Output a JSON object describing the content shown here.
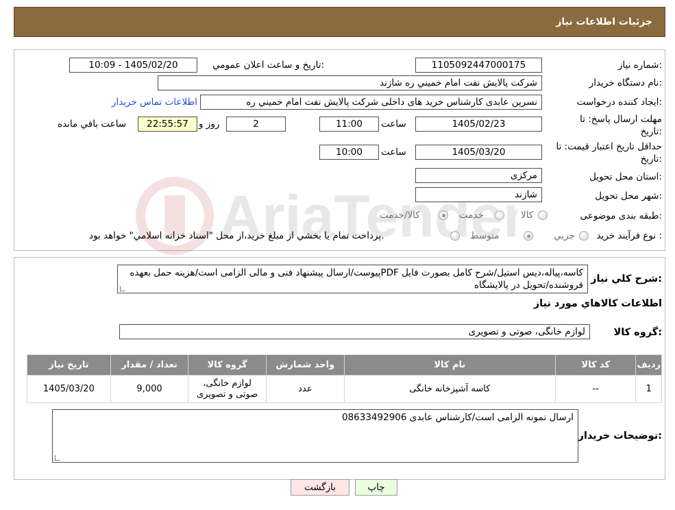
{
  "header": {
    "title": "جزئیات اطلاعات نیاز"
  },
  "form": {
    "need_number_label": "شماره نیاز:",
    "need_number": "1105092447000175",
    "announce_label": "تاریخ و ساعت اعلان عمومي:",
    "announce_value": "1405/02/20 - 10:09",
    "buyer_org_label": "نام دستگاه خريدار:",
    "buyer_org": "شرکت پالايش نفت امام خميني  ره  شازند",
    "creator_label": "ايجاد كننده درخواست:",
    "creator": "نسرين عابدی کارشناس خريد های داخلی  شرکت پالايش نفت امام خميني  ره",
    "contact_link": "اطلاعات تماس خريدار",
    "deadline_label_1": "مهلت ارسال پاسخ: تا",
    "deadline_label_2": "تاريخ:",
    "deadline_date": "1405/02/23",
    "time_label": "ساعت",
    "deadline_time": "11:00",
    "days": "2",
    "days_label": "روز و",
    "remaining": "22:55:57",
    "remaining_label": "ساعت باقي مانده",
    "validity_label_1": "حداقل تاريخ اعتبار قيمت: تا",
    "validity_label_2": "تاريخ:",
    "validity_date": "1405/03/20",
    "validity_time_label": "ساعت",
    "validity_time": "10:00",
    "province_label": "استان محل تحويل:",
    "province": "مرکزی",
    "city_label": "شهر محل تحويل:",
    "city": "شازند",
    "category_label": "طبقه بندی موضوعی:",
    "category_options": [
      "کالا",
      "خدمت",
      "کالا/خدمت"
    ],
    "process_label": "نوع فرآيند خريد :",
    "process_options": [
      "جزيي",
      "متوسط"
    ],
    "process_note": "پرداخت تمام يا بخشي از مبلغ خريد،از محل \"اسناد خزانه اسلامي\" خواهد بود."
  },
  "summary": {
    "label": "شرح كلي نياز:",
    "text": "کاسه،پیاله،دیس استیل/شرح کامل بصورت فایل PDFپیوست/ارسال پیشنهاد فنی و مالی الزامی است/هزینه حمل بعهده فروشنده/تحویل در پالایشگاه",
    "items_title": "اطلاعات كالاهاي مورد نياز",
    "group_label": "گروه كالا:",
    "group_value": "لوازم خانگی، صوتی و تصویری"
  },
  "table": {
    "headers": [
      "رديف",
      "كد كالا",
      "نام كالا",
      "واحد شمارش",
      "گروه كالا",
      "تعداد / مقدار",
      "تاريخ نياز"
    ],
    "rows": [
      [
        "1",
        "--",
        "کاسه آشپزخانه خانگی",
        "عدد",
        "لوازم خانگی، صوتی و تصویری",
        "9,000",
        "1405/03/20"
      ]
    ]
  },
  "buyer_notes": {
    "label": "توضيحات خريدار:",
    "text": "ارسال نمونه الزامی است/کارشناس عابدی 08633492906"
  },
  "buttons": {
    "print": "چاپ",
    "back": "بازگشت"
  },
  "colors": {
    "header_bg": "#8b6a3e",
    "table_header_bg": "#8b8b8b",
    "print_bg": "#e9ffe0",
    "back_bg": "#ffe6e6"
  }
}
